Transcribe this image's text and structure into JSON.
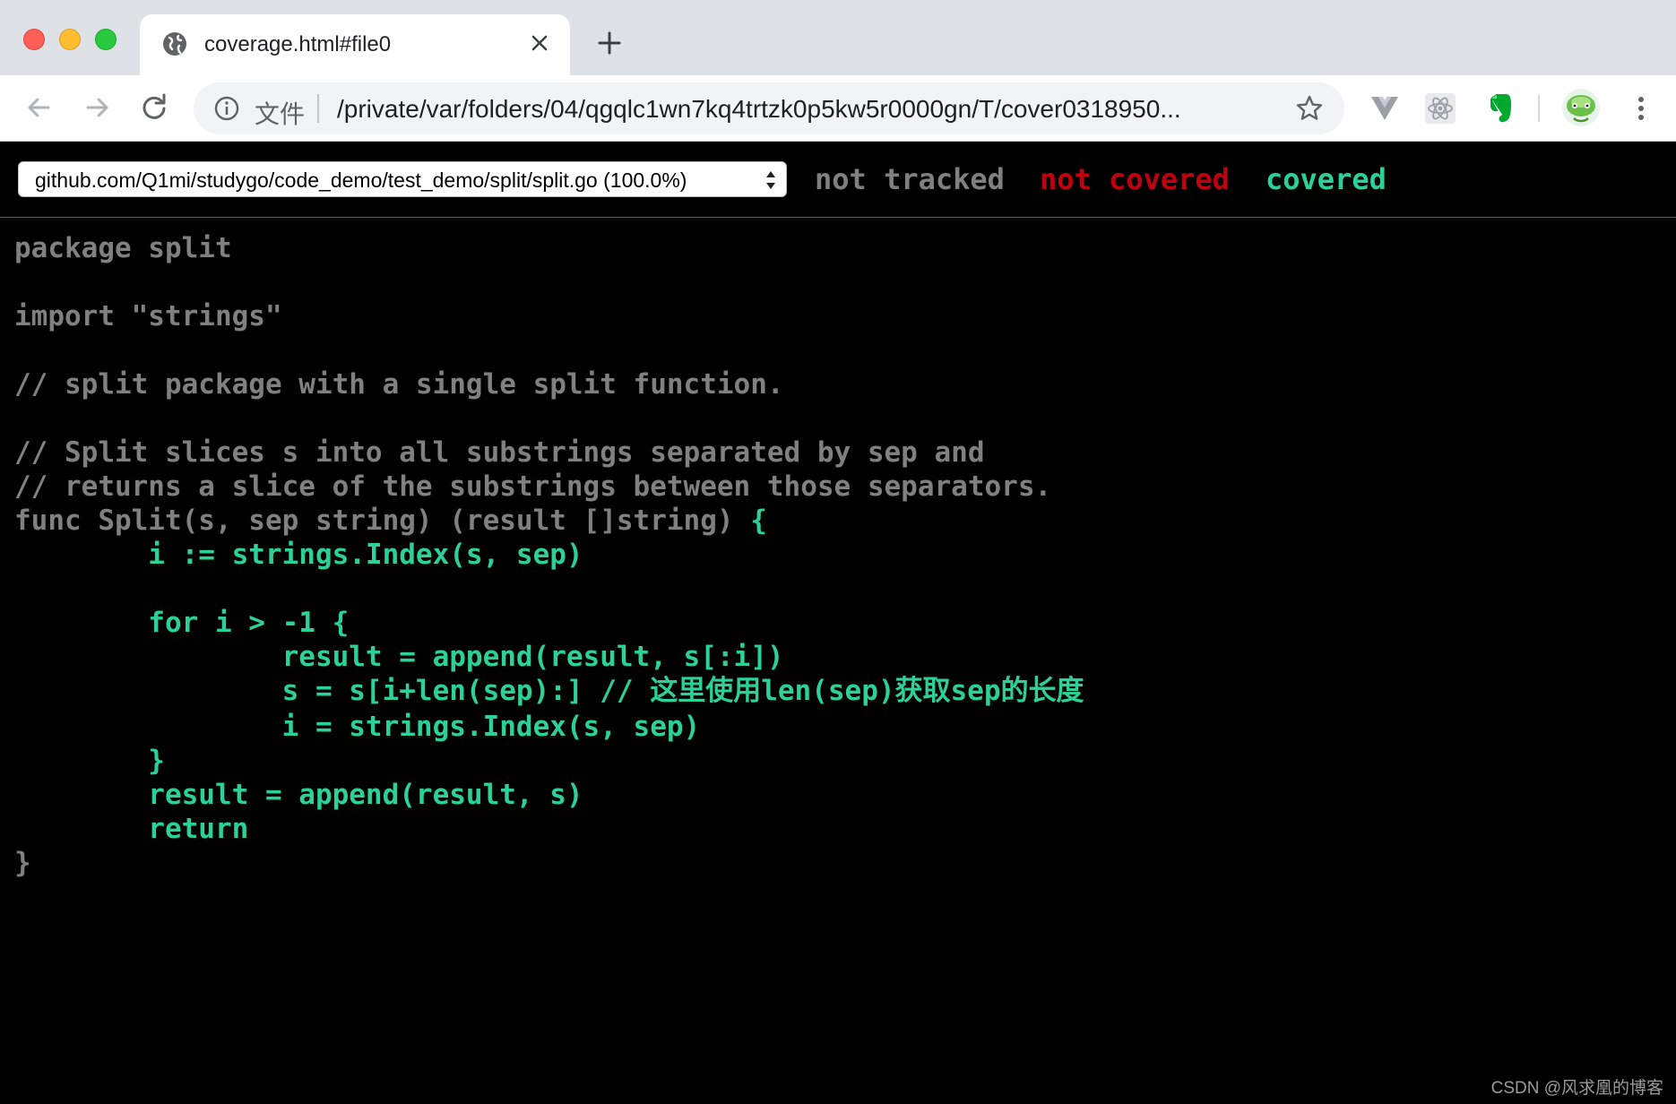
{
  "browser": {
    "tab": {
      "title": "coverage.html#file0"
    },
    "omnibox": {
      "security_label": "文件",
      "url": "/private/var/folders/04/qgqlc1wn7kq4trtzk0p5kw5r0000gn/T/cover0318950..."
    },
    "toolbar_icons": [
      "back-icon",
      "forward-icon",
      "reload-icon",
      "info-icon",
      "star-icon",
      "vue-extension-icon",
      "react-extension-icon",
      "evernote-extension-icon",
      "profile-avatar",
      "menu-icon"
    ]
  },
  "coverage": {
    "file_select": "github.com/Q1mi/studygo/code_demo/test_demo/split/split.go (100.0%)",
    "legend": {
      "not_tracked": "not tracked",
      "not_covered": "not covered",
      "covered": "covered"
    },
    "colors": {
      "not_tracked": "#808080",
      "not_covered": "#c0000e",
      "covered": "#2cd198",
      "background": "#000000"
    }
  },
  "source": {
    "lines": [
      {
        "text": "package split",
        "status": "not_tracked"
      },
      {
        "text": "",
        "status": "not_tracked"
      },
      {
        "text": "import \"strings\"",
        "status": "not_tracked"
      },
      {
        "text": "",
        "status": "not_tracked"
      },
      {
        "text": "// split package with a single split function.",
        "status": "not_tracked"
      },
      {
        "text": "",
        "status": "not_tracked"
      },
      {
        "text": "// Split slices s into all substrings separated by sep and",
        "status": "not_tracked"
      },
      {
        "text": "// returns a slice of the substrings between those separators.",
        "status": "not_tracked"
      },
      {
        "text": "func Split(s, sep string) (result []string) ",
        "status": "not_tracked",
        "tail": "{",
        "tail_status": "covered"
      },
      {
        "text": "        i := strings.Index(s, sep)",
        "status": "covered"
      },
      {
        "text": "",
        "status": "covered"
      },
      {
        "text": "        for i > -1 {",
        "status": "covered"
      },
      {
        "text": "                result = append(result, s[:i])",
        "status": "covered"
      },
      {
        "text": "                s = s[i+len(sep):] // 这里使用len(sep)获取sep的长度",
        "status": "covered"
      },
      {
        "text": "                i = strings.Index(s, sep)",
        "status": "covered"
      },
      {
        "text": "        }",
        "status": "covered"
      },
      {
        "text": "        result = append(result, s)",
        "status": "covered"
      },
      {
        "text": "        return",
        "status": "covered"
      },
      {
        "text": "}",
        "status": "not_tracked"
      }
    ]
  },
  "watermark": "CSDN @风求凰的博客"
}
